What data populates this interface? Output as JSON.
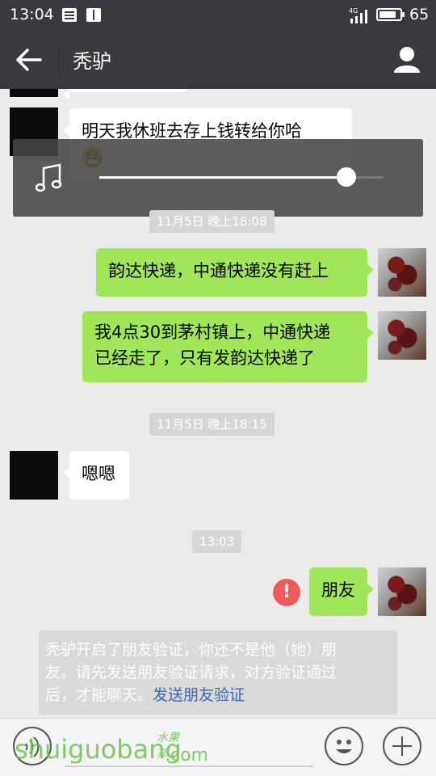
{
  "status_bar": {
    "time": "13:04",
    "network": "4G",
    "battery": "65"
  },
  "header": {
    "title": "秃驴"
  },
  "messages": [
    {
      "side": "left",
      "text": "明天我休班去存上钱转给你哈",
      "emoji": "grin-emoji"
    },
    {
      "timestamp": "11月5日 晚上18:08"
    },
    {
      "side": "right",
      "text": "韵达快递，中通快递没有赶上"
    },
    {
      "side": "right",
      "line1": "我4点30到茅村镇上，中通快递",
      "line2": "已经走了，只有发韵达快递了"
    },
    {
      "timestamp": "11月5日 晚上18:15"
    },
    {
      "side": "left",
      "text": "嗯嗯"
    },
    {
      "timestamp": "13:03"
    },
    {
      "side": "right",
      "text": "朋友",
      "status": "failed"
    }
  ],
  "music_player": {
    "icon": "music-note-icon",
    "progress": 0.87
  },
  "system_message": {
    "line1": "秃驴开启了朋友验证，你还不是他（她）朋",
    "line2": "友。请先发送朋友验证请求，对方验证通过",
    "line3_prefix": "后，才能聊天。",
    "link": "发送朋友验证"
  },
  "alert_glyph": "!",
  "watermark": {
    "text": "shuiguobang",
    "dot_com": ".com",
    "cn": "水果邦"
  },
  "colors": {
    "header_bg": "#393a3f",
    "sent_bubble": "#9fe658",
    "received_bubble": "#ffffff",
    "alert": "#f05a5a",
    "link": "#3a6aa8"
  }
}
